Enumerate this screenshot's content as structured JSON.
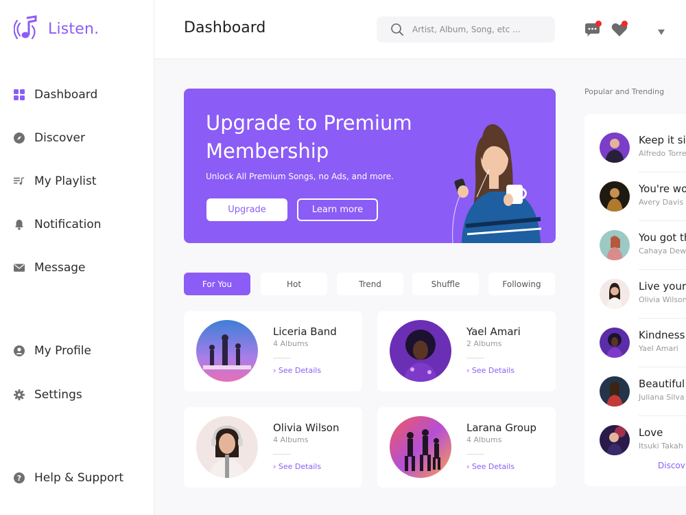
{
  "app": {
    "name": "Listen.",
    "accent": "#8b5cf6"
  },
  "sidebar": {
    "items": [
      {
        "label": "Dashboard",
        "icon": "grid-icon"
      },
      {
        "label": "Discover",
        "icon": "compass-icon"
      },
      {
        "label": "My Playlist",
        "icon": "playlist-icon"
      },
      {
        "label": "Notification",
        "icon": "bell-icon"
      },
      {
        "label": "Message",
        "icon": "envelope-icon"
      },
      {
        "label": "My Profile",
        "icon": "user-circle-icon"
      },
      {
        "label": "Settings",
        "icon": "gear-icon"
      },
      {
        "label": "Help & Support",
        "icon": "help-circle-icon"
      }
    ]
  },
  "header": {
    "title": "Dashboard",
    "search_placeholder": "Artist, Album, Song, etc ...",
    "notification_color": "#ef2b2b"
  },
  "banner": {
    "title": "Upgrade to Premium Membership",
    "subtitle": "Unlock All Premium Songs, no Ads, and more.",
    "primary_button": "Upgrade",
    "secondary_button": "Learn more"
  },
  "tabs": [
    "For You",
    "Hot",
    "Trend",
    "Shuffle",
    "Following"
  ],
  "artists": [
    {
      "name": "Liceria Band",
      "albums": "4 Albums",
      "link": "› See Details"
    },
    {
      "name": "Yael Amari",
      "albums": "2 Albums",
      "link": "› See Details"
    },
    {
      "name": "Olivia Wilson",
      "albums": "4 Albums",
      "link": "› See Details"
    },
    {
      "name": "Larana Group",
      "albums": "4 Albums",
      "link": "› See Details"
    }
  ],
  "trending": {
    "title": "Popular and Trending",
    "items": [
      {
        "song": "Keep it si",
        "artist": "Alfredo Torre"
      },
      {
        "song": "You're wo",
        "artist": "Avery Davis"
      },
      {
        "song": "You got th",
        "artist": "Cahaya Dew"
      },
      {
        "song": "Live your",
        "artist": "Olivia Wilson"
      },
      {
        "song": "Kindness",
        "artist": "Yael Amari"
      },
      {
        "song": "Beautiful",
        "artist": "Juliana Silva"
      },
      {
        "song": "Love",
        "artist": "Itsuki Takah"
      }
    ],
    "link": "Discov"
  }
}
